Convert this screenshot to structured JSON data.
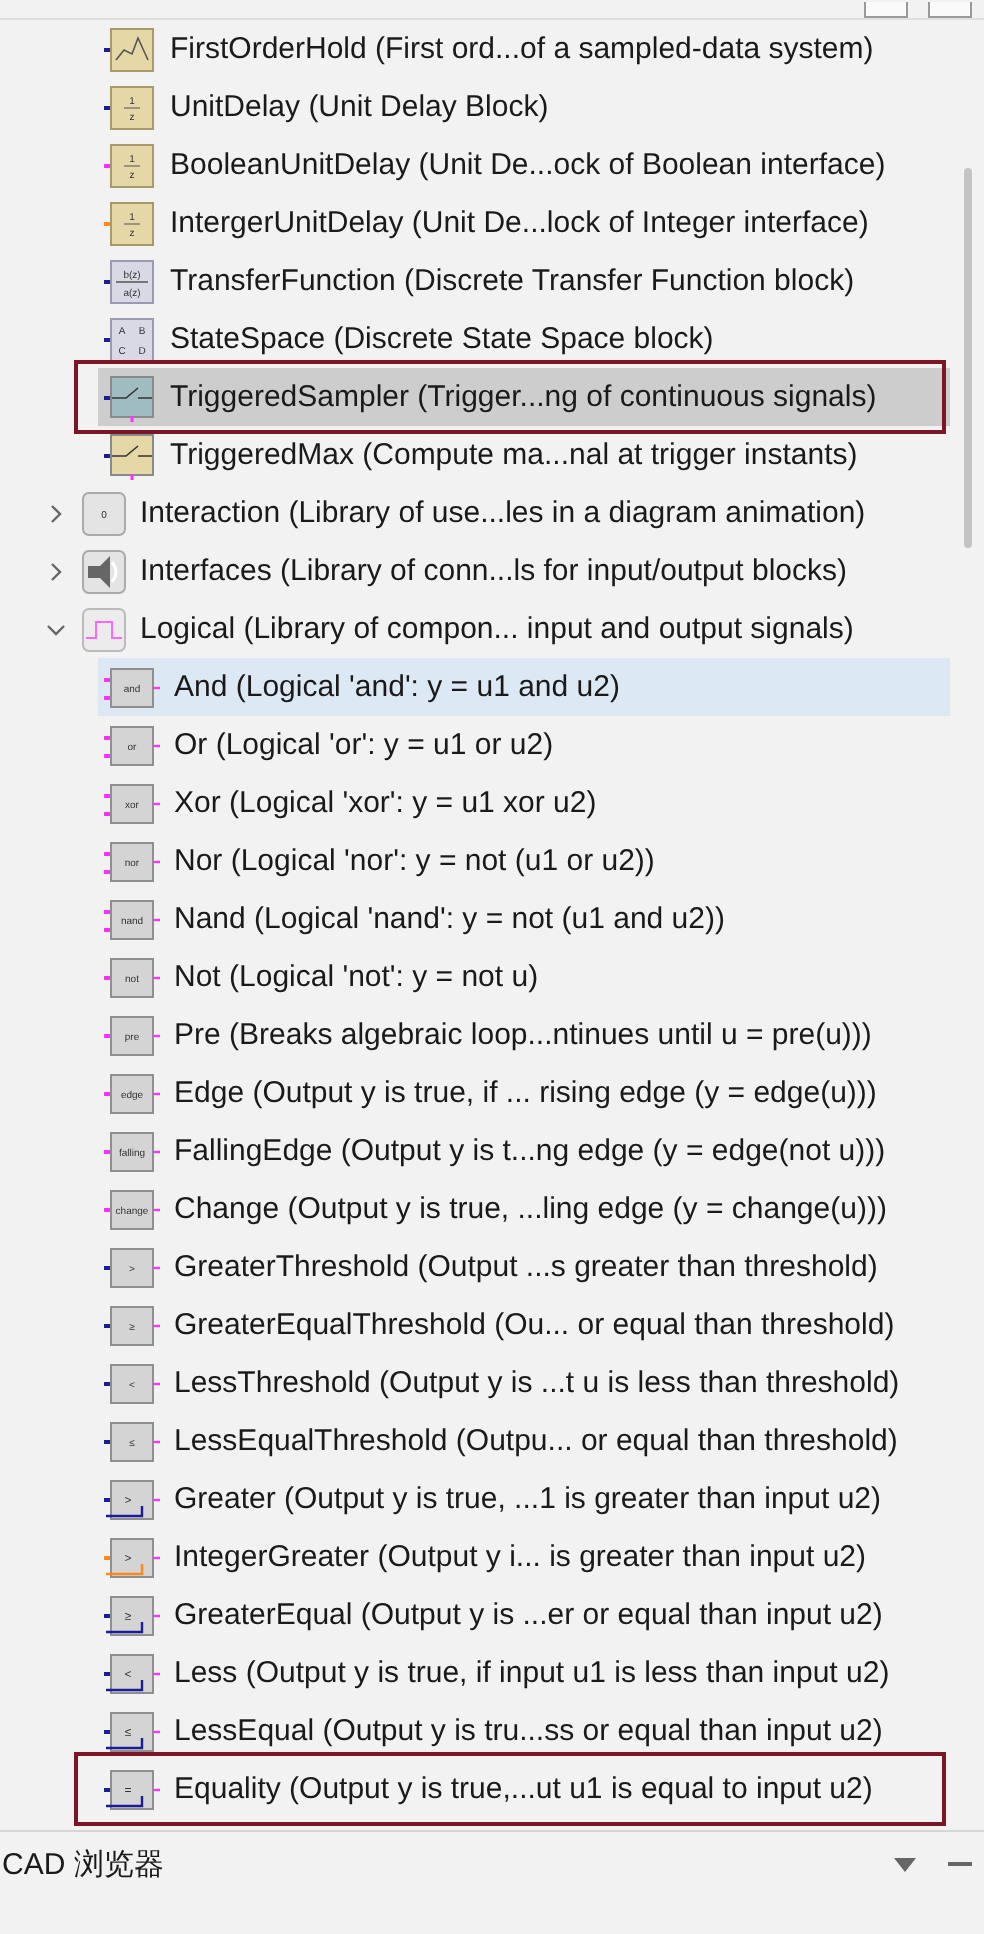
{
  "tree": {
    "continued_items": [
      {
        "label": "FirstOrderHold (First ord...of a sampled-data system)",
        "kind": "hold",
        "color": "#1c1c96",
        "selected": false,
        "hovered": false,
        "outlined": false
      },
      {
        "label": "UnitDelay (Unit Delay Block)",
        "kind": "delay",
        "icon_lines": [
          "1",
          "z"
        ],
        "color": "#1c1c96",
        "selected": false,
        "hovered": false,
        "outlined": false
      },
      {
        "label": "BooleanUnitDelay (Unit De...ock of Boolean interface)",
        "kind": "delay",
        "icon_lines": [
          "1",
          "z"
        ],
        "color": "#ff33ff",
        "selected": false,
        "hovered": false,
        "outlined": false
      },
      {
        "label": "IntergerUnitDelay (Unit De...lock of Integer interface)",
        "kind": "delay",
        "icon_lines": [
          "1",
          "z"
        ],
        "color": "#ff8a1a",
        "selected": false,
        "hovered": false,
        "outlined": false
      },
      {
        "label": "TransferFunction (Discrete Transfer Function block)",
        "kind": "transfer",
        "icon_lines": [
          "b(z)",
          "a(z)"
        ],
        "color": "#1c1c96",
        "selected": false,
        "hovered": false,
        "outlined": false
      },
      {
        "label": "StateSpace (Discrete State Space block)",
        "kind": "statespace",
        "icon_lines": [
          "A",
          "B",
          "C",
          "D"
        ],
        "color": "#1c1c96",
        "selected": false,
        "hovered": false,
        "outlined": false
      },
      {
        "label": "TriggeredSampler (Trigger...ng of continuous signals)",
        "kind": "sampler",
        "color": "#1c1c96",
        "selected": true,
        "hovered": false,
        "outlined": true
      },
      {
        "label": "TriggeredMax (Compute ma...nal at trigger instants)",
        "kind": "triggered",
        "color": "#1c1c96",
        "selected": false,
        "hovered": false,
        "outlined": false
      }
    ],
    "items": [
      {
        "label": "Interaction (Library of use...les in a diagram animation)",
        "kind": "interaction",
        "icon_lines": [
          "0"
        ],
        "expanded": false,
        "selected": false,
        "hovered": false,
        "outlined": false
      },
      {
        "label": "Interfaces (Library of conn...ls for input/output blocks)",
        "kind": "interfaces",
        "expanded": false,
        "selected": false,
        "hovered": false,
        "outlined": false
      },
      {
        "label": "Logical (Library of compon... input and output signals)",
        "kind": "logical",
        "expanded": true,
        "selected": false,
        "hovered": false,
        "outlined": false,
        "children": [
          {
            "label": "And (Logical 'and': y = u1 and u2)",
            "kind": "logic",
            "icon_lines": [
              "and"
            ],
            "color": "#ff33ff",
            "selected": false,
            "hovered": true,
            "outlined": false
          },
          {
            "label": "Or (Logical 'or': y = u1 or u2)",
            "kind": "logic",
            "icon_lines": [
              "or"
            ],
            "color": "#ff33ff",
            "selected": false,
            "hovered": false,
            "outlined": false
          },
          {
            "label": "Xor (Logical 'xor': y = u1 xor u2)",
            "kind": "logic",
            "icon_lines": [
              "xor"
            ],
            "color": "#ff33ff",
            "selected": false,
            "hovered": false,
            "outlined": false
          },
          {
            "label": "Nor (Logical 'nor': y = not (u1 or u2))",
            "kind": "logic",
            "icon_lines": [
              "nor"
            ],
            "color": "#ff33ff",
            "selected": false,
            "hovered": false,
            "outlined": false
          },
          {
            "label": "Nand (Logical 'nand': y = not (u1 and u2))",
            "kind": "logic",
            "icon_lines": [
              "nand"
            ],
            "color": "#ff33ff",
            "selected": false,
            "hovered": false,
            "outlined": false
          },
          {
            "label": "Not (Logical 'not': y = not u)",
            "kind": "logic1",
            "icon_lines": [
              "not"
            ],
            "color": "#ff33ff",
            "selected": false,
            "hovered": false,
            "outlined": false
          },
          {
            "label": "Pre (Breaks algebraic loop...ntinues until u = pre(u)))",
            "kind": "logic1",
            "icon_lines": [
              "pre"
            ],
            "color": "#ff33ff",
            "selected": false,
            "hovered": false,
            "outlined": false
          },
          {
            "label": "Edge (Output y is true, if ... rising edge (y = edge(u)))",
            "kind": "logic1",
            "icon_lines": [
              "edge"
            ],
            "color": "#ff33ff",
            "selected": false,
            "hovered": false,
            "outlined": false
          },
          {
            "label": "FallingEdge (Output y is t...ng edge (y = edge(not u)))",
            "kind": "logic1",
            "icon_lines": [
              "falling"
            ],
            "color": "#ff33ff",
            "selected": false,
            "hovered": false,
            "outlined": false
          },
          {
            "label": "Change (Output y is true, ...ling edge (y = change(u)))",
            "kind": "logic1",
            "icon_lines": [
              "change"
            ],
            "color": "#ff33ff",
            "selected": false,
            "hovered": false,
            "outlined": false
          },
          {
            "label": "GreaterThreshold (Output ...s greater than threshold)",
            "kind": "logic1",
            "icon_lines": [
              ">"
            ],
            "color": "#1c1c96",
            "selected": false,
            "hovered": false,
            "outlined": false
          },
          {
            "label": "GreaterEqualThreshold (Ou... or equal than threshold)",
            "kind": "logic1",
            "icon_lines": [
              "≥"
            ],
            "color": "#1c1c96",
            "selected": false,
            "hovered": false,
            "outlined": false
          },
          {
            "label": "LessThreshold (Output y is ...t u is less than threshold)",
            "kind": "logic1",
            "icon_lines": [
              "<"
            ],
            "color": "#1c1c96",
            "selected": false,
            "hovered": false,
            "outlined": false
          },
          {
            "label": "LessEqualThreshold (Outpu... or equal than threshold)",
            "kind": "logic1",
            "icon_lines": [
              "≤"
            ],
            "color": "#1c1c96",
            "selected": false,
            "hovered": false,
            "outlined": false
          },
          {
            "label": "Greater (Output y is true, ...1 is greater than input u2)",
            "kind": "compare",
            "icon_lines": [
              ">"
            ],
            "color": "#1c1c96",
            "selected": false,
            "hovered": false,
            "outlined": false
          },
          {
            "label": "IntegerGreater (Output y i... is greater than input u2)",
            "kind": "compare",
            "icon_lines": [
              ">"
            ],
            "color": "#ff8a1a",
            "selected": false,
            "hovered": false,
            "outlined": false
          },
          {
            "label": "GreaterEqual (Output y is ...er or equal than input u2)",
            "kind": "compare",
            "icon_lines": [
              "≥"
            ],
            "color": "#1c1c96",
            "selected": false,
            "hovered": false,
            "outlined": false
          },
          {
            "label": "Less (Output y is true, if input u1 is less than input u2)",
            "kind": "compare",
            "icon_lines": [
              "<"
            ],
            "color": "#1c1c96",
            "selected": false,
            "hovered": false,
            "outlined": false
          },
          {
            "label": "LessEqual (Output y is tru...ss or equal than input u2)",
            "kind": "compare",
            "icon_lines": [
              "≤"
            ],
            "color": "#1c1c96",
            "selected": false,
            "hovered": false,
            "outlined": false
          },
          {
            "label": "Equality (Output y is true,...ut u1 is equal to input u2)",
            "kind": "compare",
            "icon_lines": [
              "="
            ],
            "color": "#1c1c96",
            "selected": false,
            "hovered": false,
            "outlined": true
          }
        ]
      }
    ]
  },
  "bottom_panel": {
    "title": "CAD 浏览器"
  }
}
